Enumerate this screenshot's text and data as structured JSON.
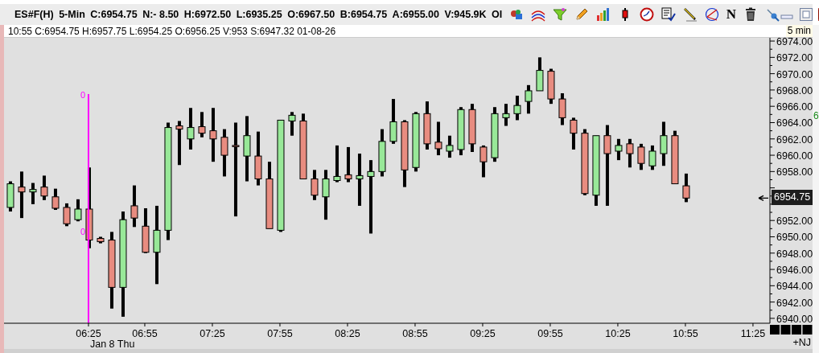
{
  "header": {
    "fields": [
      "ES#F(H)",
      "5-Min",
      "C:6954.75",
      "N:- 8.50",
      "H:6972.50",
      "L:6935.25",
      "O:6967.50",
      "B:6954.75",
      "A:6955.00",
      "V:945.9K",
      "OI"
    ],
    "tool_letter": "N"
  },
  "info_line": "10:55 C:6954.75 H:6957.75 L:6954.25 O:6956.25 V:953 S:6947.32 01-08-26",
  "interval": "5 min",
  "chart": {
    "kind": "candlestick-picture",
    "price_labels": [
      "6974.00",
      "6972.00",
      "6970.00",
      "6968.00",
      "6966.00",
      "6964.00",
      "6962.00",
      "6960.00",
      "6958.00",
      "6952.00",
      "6950.00",
      "6948.00",
      "6946.00",
      "6944.00",
      "6942.00",
      "6940.00"
    ],
    "time_labels": [
      "06:25",
      "06:55",
      "07:25",
      "07:55",
      "08:25",
      "08:55",
      "09:25",
      "09:55",
      "10:25",
      "10:55",
      "11:25"
    ],
    "last_price": "6954.75",
    "date_label": "Jan 8 Thu",
    "marker_labels": [
      "0",
      "0"
    ],
    "corner_label": "+NJ"
  },
  "side_label": "6"
}
